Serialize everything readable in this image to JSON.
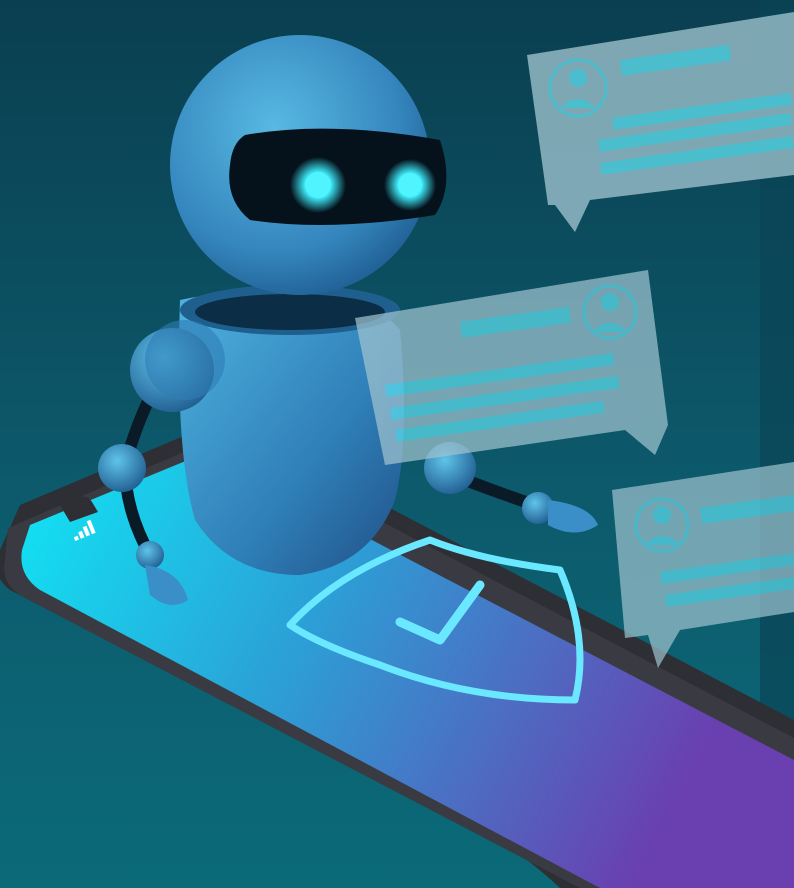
{
  "illustration": {
    "subject": "chatbot-robot-on-smartphone",
    "icons": [
      "robot-icon",
      "smartphone-icon",
      "shield-check-icon",
      "user-avatar-icon",
      "chat-bubble-icon",
      "signal-icon"
    ],
    "colors": {
      "background_top": "#0a3f50",
      "background_bottom": "#0b6a7a",
      "robot_light": "#4fb3df",
      "robot_dark": "#1a5a8c",
      "visor": "#05121c",
      "eye_glow": "#3ff0ff",
      "screen_left": "#13e2f2",
      "screen_right": "#6a3fb0",
      "phone_frame": "#3a3a40",
      "bubble_fill": "#9fc3cf",
      "bubble_line": "#5ee0f0",
      "shield_stroke": "#6ae8ff"
    }
  }
}
